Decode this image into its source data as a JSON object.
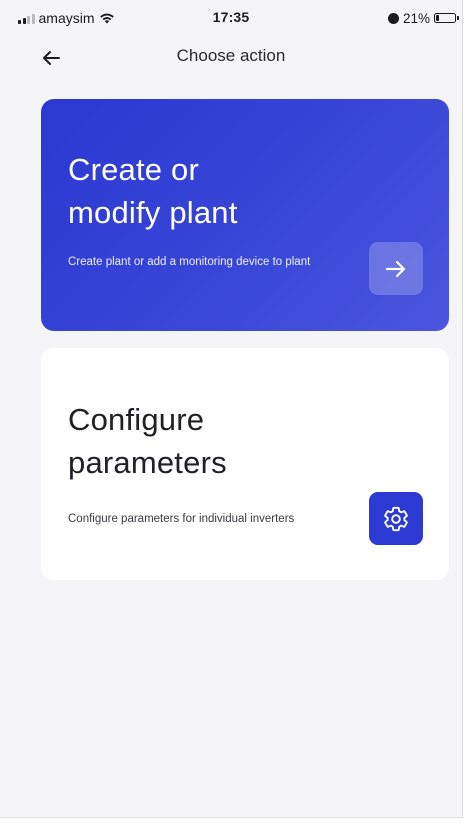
{
  "status_bar": {
    "carrier": "amaysim",
    "time": "17:35",
    "battery": "21%",
    "battery_level": 0.21,
    "icons": [
      "signal-icon",
      "wifi-icon",
      "alarm-icon",
      "battery-icon"
    ]
  },
  "header": {
    "title": "Choose action",
    "back_icon": "arrow-left-icon"
  },
  "cards": [
    {
      "title_line1": "Create or",
      "title_line2": "modify plant",
      "description": "Create plant or add a monitoring device to plant",
      "action_icon": "arrow-right-icon"
    },
    {
      "title_line1": "Configure",
      "title_line2": "parameters",
      "description": "Configure parameters for individual inverters",
      "action_icon": "gear-icon"
    }
  ],
  "colors": {
    "accent": "#2c39d2",
    "background": "#f5f5f7",
    "card_light": "#ffffff",
    "text_dark": "#202127"
  }
}
